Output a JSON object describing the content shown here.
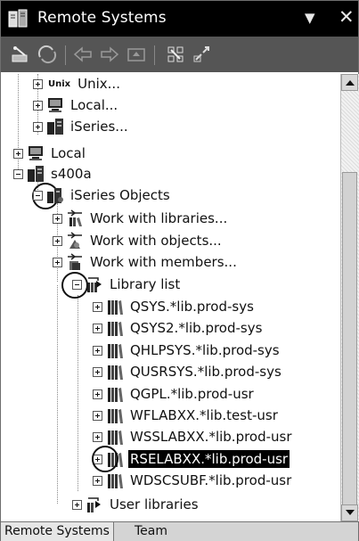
{
  "window": {
    "title": "Remote Systems",
    "menu_glyph": "▼",
    "close_glyph": "✕"
  },
  "tree": {
    "unix_tag": "Unix",
    "items": [
      {
        "label": "Unix...",
        "icon": "unix-icon",
        "expander": "plus"
      },
      {
        "label": "Local...",
        "icon": "local-system-icon",
        "expander": "plus"
      },
      {
        "label": "iSeries...",
        "icon": "iseries-icon",
        "expander": "plus"
      },
      {
        "label": "Local",
        "icon": "local-system-icon",
        "expander": "plus"
      },
      {
        "label": "s400a",
        "icon": "iseries-icon",
        "expander": "minus"
      },
      {
        "label": "iSeries Objects",
        "icon": "iseries-objects-icon",
        "expander": "minus"
      },
      {
        "label": "Work with libraries...",
        "icon": "work-with-libraries-icon",
        "expander": "plus"
      },
      {
        "label": "Work with objects...",
        "icon": "work-with-objects-icon",
        "expander": "plus"
      },
      {
        "label": "Work with members...",
        "icon": "work-with-members-icon",
        "expander": "plus"
      },
      {
        "label": "Library list",
        "icon": "library-list-icon",
        "expander": "minus"
      },
      {
        "label": "QSYS.*lib.prod-sys",
        "icon": "library-icon",
        "expander": "plus"
      },
      {
        "label": "QSYS2.*lib.prod-sys",
        "icon": "library-icon",
        "expander": "plus"
      },
      {
        "label": "QHLPSYS.*lib.prod-sys",
        "icon": "library-icon",
        "expander": "plus"
      },
      {
        "label": "QUSRSYS.*lib.prod-sys",
        "icon": "library-icon",
        "expander": "plus"
      },
      {
        "label": "QGPL.*lib.prod-usr",
        "icon": "library-icon",
        "expander": "plus"
      },
      {
        "label": "WFLABXX.*lib.test-usr",
        "icon": "library-icon",
        "expander": "plus"
      },
      {
        "label": "WSSLABXX.*lib.prod-usr",
        "icon": "library-icon",
        "expander": "plus"
      },
      {
        "label": "RSELABXX.*lib.prod-usr",
        "icon": "library-icon",
        "expander": "plus",
        "selected": true
      },
      {
        "label": "WDSCSUBF.*lib.prod-usr",
        "icon": "library-icon",
        "expander": "plus"
      },
      {
        "label": "User libraries",
        "icon": "user-libraries-icon",
        "expander": "plus"
      }
    ]
  },
  "tabs": [
    {
      "label": "Remote Systems",
      "active": true
    },
    {
      "label": "Team",
      "active": false
    }
  ],
  "colors": {
    "title_bar": "#000000",
    "toolbar": "#555555",
    "selection": "#000000"
  }
}
